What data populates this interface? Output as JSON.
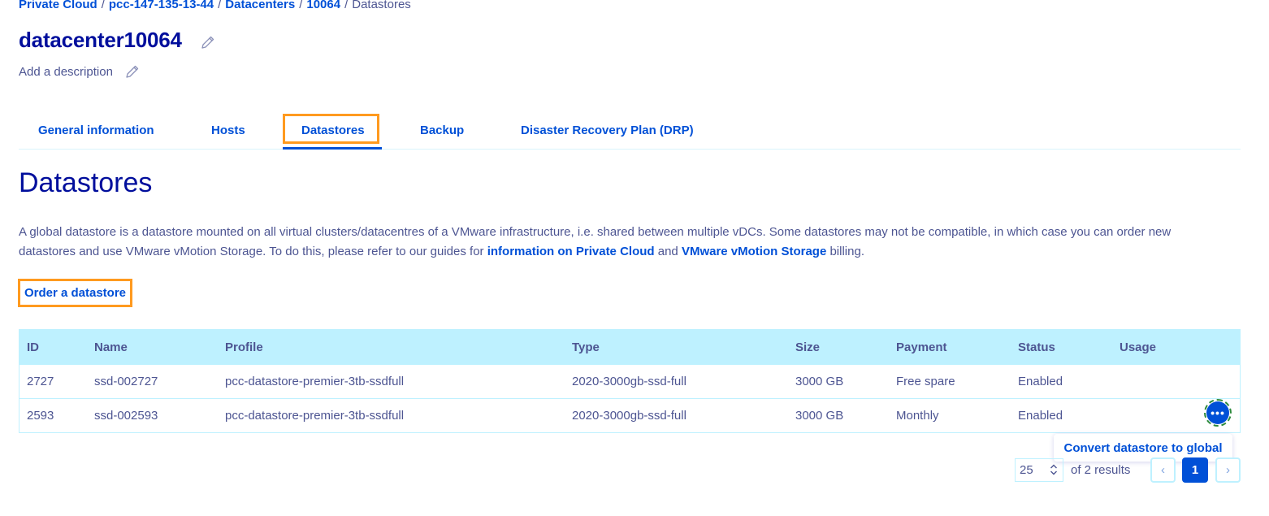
{
  "breadcrumb": {
    "items": [
      {
        "label": "Private Cloud"
      },
      {
        "label": "pcc-147-135-13-44"
      },
      {
        "label": "Datacenters"
      },
      {
        "label": "10064"
      },
      {
        "label": "Datastores"
      }
    ],
    "separator": "/"
  },
  "header": {
    "title": "datacenter10064",
    "description": "Add a description",
    "edit_icon": "pencil-icon"
  },
  "tabs": [
    {
      "label": "General information"
    },
    {
      "label": "Hosts"
    },
    {
      "label": "Datastores",
      "active": true
    },
    {
      "label": "Backup"
    },
    {
      "label": "Disaster Recovery Plan (DRP)"
    }
  ],
  "section": {
    "title": "Datastores",
    "intro_part1": "A global datastore is a datastore mounted on all virtual clusters/datacentres of a VMware infrastructure, i.e. shared between multiple vDCs. Some datastores may not be compatible, in which case you can order new datastores and use VMware vMotion Storage. To do this, please refer to our guides for ",
    "intro_link1": "information on Private Cloud",
    "intro_and": " and ",
    "intro_link2": "VMware vMotion Storage",
    "intro_end": " billing.",
    "order_button": "Order a datastore"
  },
  "table": {
    "columns": [
      "ID",
      "Name",
      "Profile",
      "Type",
      "Size",
      "Payment",
      "Status",
      "Usage"
    ],
    "rows": [
      {
        "id": "2727",
        "name": "ssd-002727",
        "profile": "pcc-datastore-premier-3tb-ssdfull",
        "type": "2020-3000gb-ssd-full",
        "size": "3000 GB",
        "payment": "Free spare",
        "status": "Enabled",
        "usage": ""
      },
      {
        "id": "2593",
        "name": "ssd-002593",
        "profile": "pcc-datastore-premier-3tb-ssdfull",
        "type": "2020-3000gb-ssd-full",
        "size": "3000 GB",
        "payment": "Monthly",
        "status": "Enabled",
        "usage": ""
      }
    ],
    "row_action_icon": "ellipsis-icon",
    "row_action_glyph": "•••"
  },
  "popover": {
    "menu_item": "Convert datastore to global"
  },
  "pagination": {
    "page_size": "25",
    "results_text": "of 2 results",
    "current_page": "1",
    "prev_glyph": "‹",
    "next_glyph": "›"
  },
  "colors": {
    "primary": "#0050d7",
    "heading": "#000e9c",
    "text": "#4d5592",
    "table_header_bg": "#bef1ff",
    "highlight_box": "#ff9a1f"
  }
}
